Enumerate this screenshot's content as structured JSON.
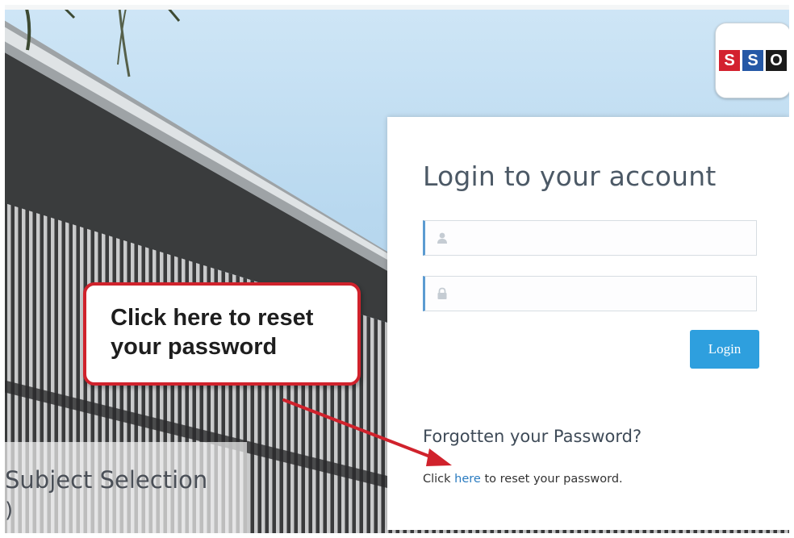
{
  "logo": {
    "letters": [
      "S",
      "S",
      "O"
    ],
    "colors": [
      "#d3212f",
      "#2558a6",
      "#1a1a1a"
    ]
  },
  "login": {
    "title": "Login to your account",
    "username_icon": "user-icon",
    "password_icon": "lock-icon",
    "username_value": "",
    "password_value": "",
    "button_label": "Login",
    "button_color": "#2e9fde"
  },
  "forgot": {
    "title": "Forgotten your Password?",
    "prefix": "Click ",
    "link_text": "here",
    "suffix": " to reset your password.",
    "link_color": "#2a7bc0"
  },
  "subject_panel": {
    "title": "Subject Selection",
    "subtitle": ")"
  },
  "callout": {
    "text": "Click here to reset your password",
    "border_color": "#d0222c",
    "arrow_color": "#d0222c"
  }
}
